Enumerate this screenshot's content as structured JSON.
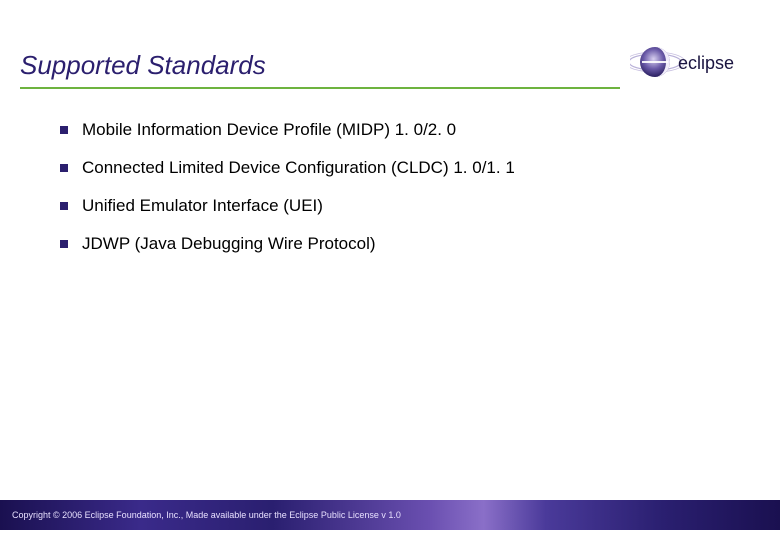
{
  "title": "Supported Standards",
  "logo_text": "eclipse",
  "bullets": [
    "Mobile Information Device Profile (MIDP) 1. 0/2. 0",
    "Connected Limited Device Configuration (CLDC) 1. 0/1. 1",
    "Unified Emulator Interface (UEI)",
    "JDWP (Java Debugging Wire Protocol)"
  ],
  "footer": "Copyright © 2006 Eclipse Foundation, Inc., Made available under the Eclipse Public License v 1.0"
}
